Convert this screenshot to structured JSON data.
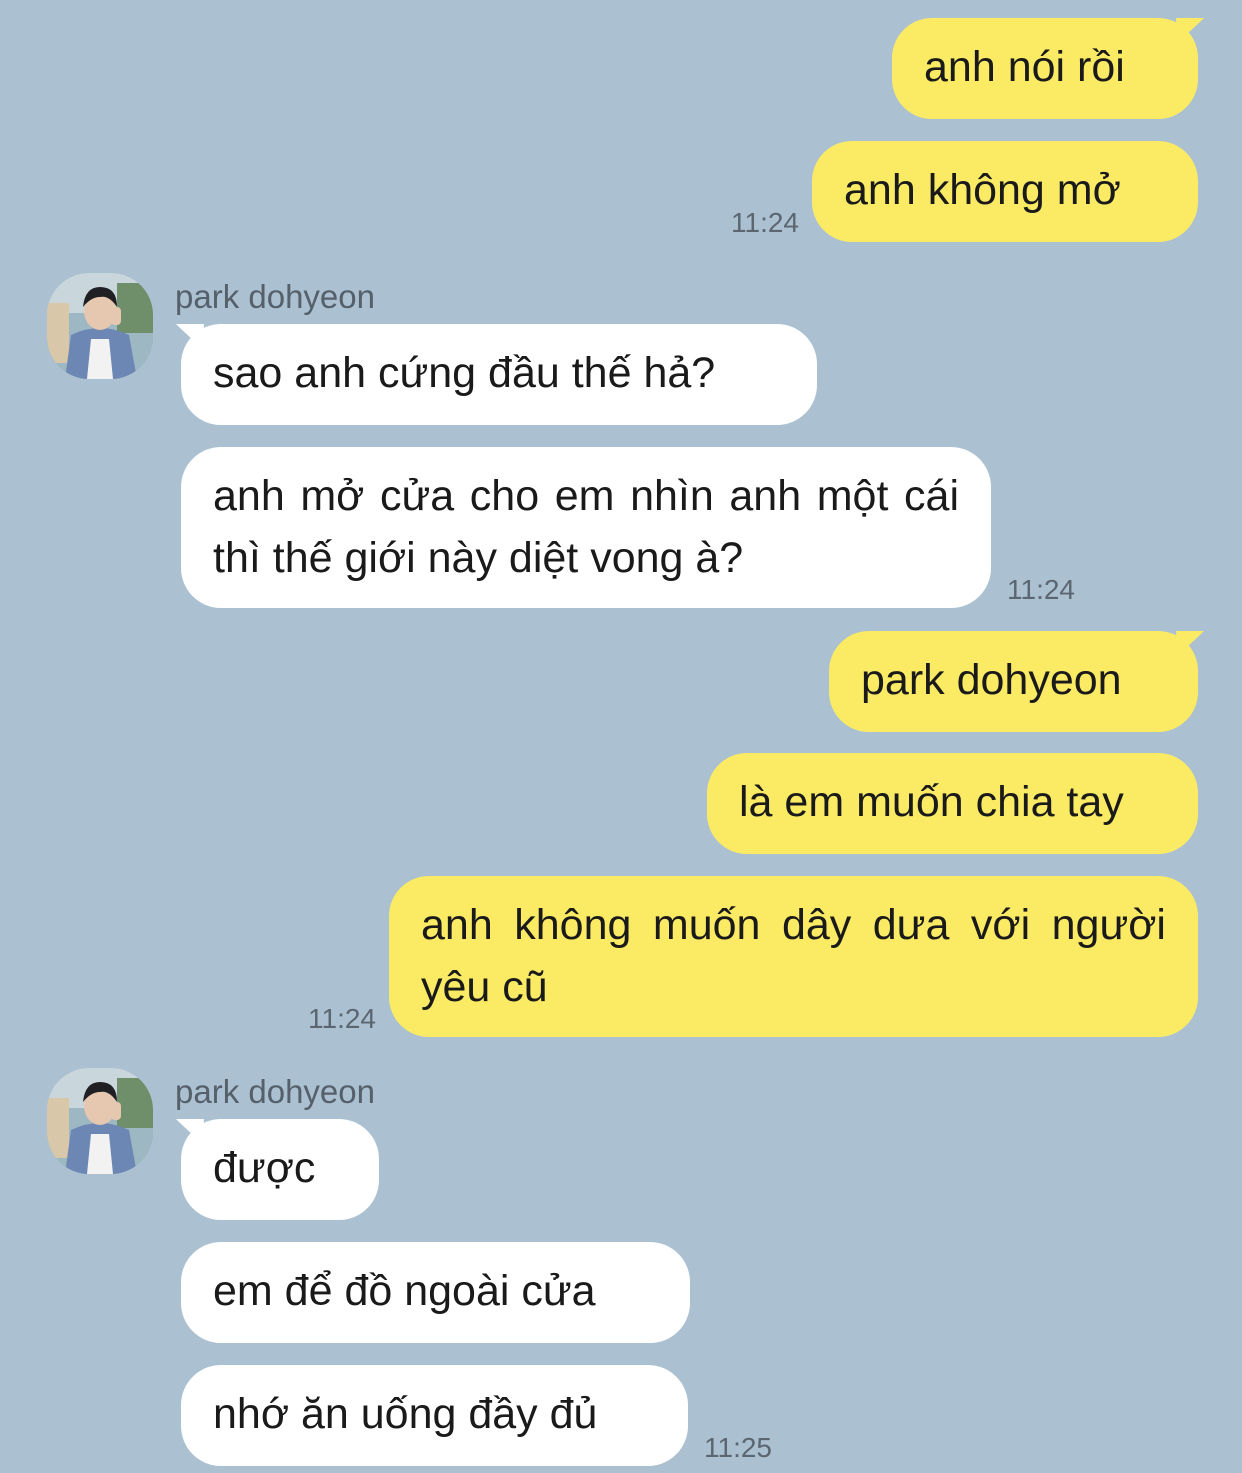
{
  "colors": {
    "background": "#abc1d1",
    "outgoing_bubble": "#fbeb64",
    "incoming_bubble": "#ffffff",
    "timestamp": "#5c6670",
    "sender_name": "#55606a"
  },
  "messages": [
    {
      "id": "m1",
      "direction": "outgoing",
      "text": "anh nói rồi"
    },
    {
      "id": "m2",
      "direction": "outgoing",
      "text": "anh không mở",
      "time": "11:24"
    },
    {
      "id": "m3",
      "direction": "incoming",
      "sender": "park dohyeon",
      "text": "sao anh cứng đầu thế hả?"
    },
    {
      "id": "m4",
      "direction": "incoming",
      "text": "anh mở cửa cho em nhìn anh một cái thì thế giới này diệt vong à?",
      "time": "11:24"
    },
    {
      "id": "m5",
      "direction": "outgoing",
      "text": "park dohyeon"
    },
    {
      "id": "m6",
      "direction": "outgoing",
      "text": "là em muốn chia tay"
    },
    {
      "id": "m7",
      "direction": "outgoing",
      "text": "anh không muốn dây dưa với người yêu cũ",
      "time": "11:24"
    },
    {
      "id": "m8",
      "direction": "incoming",
      "sender": "park dohyeon",
      "text": "được"
    },
    {
      "id": "m9",
      "direction": "incoming",
      "text": "em để đồ ngoài cửa"
    },
    {
      "id": "m10",
      "direction": "incoming",
      "text": "nhớ ăn uống đầy đủ",
      "time": "11:25"
    }
  ],
  "icons": {
    "avatar": "profile-photo-avatar"
  }
}
